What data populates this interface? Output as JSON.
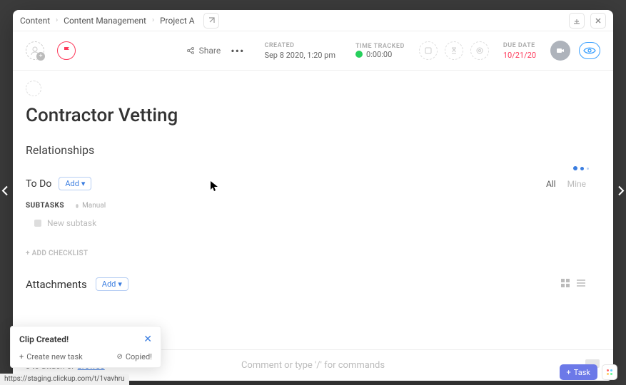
{
  "breadcrumb": {
    "items": [
      "Content",
      "Content Management",
      "Project A"
    ]
  },
  "header": {
    "share_label": "Share",
    "created_label": "CREATED",
    "created_value": "Sep 8 2020, 1:20 pm",
    "time_tracked_label": "TIME TRACKED",
    "time_tracked_value": "0:00:00",
    "due_label": "DUE DATE",
    "due_value": "10/21/20"
  },
  "task": {
    "title": "Contractor Vetting",
    "relationships_label": "Relationships"
  },
  "todo": {
    "label": "To Do",
    "add_label": "Add",
    "tabs": {
      "all": "All",
      "mine": "Mine"
    },
    "subtasks_label": "SUBTASKS",
    "manual_label": "Manual",
    "new_subtask_placeholder": "New subtask",
    "add_checklist_label": "+ ADD CHECKLIST"
  },
  "attachments": {
    "label": "Attachments",
    "add_label": "Add"
  },
  "footer": {
    "drop_prefix": "e to attach or ",
    "browse_label": "browse",
    "comment_placeholder": "Comment or type '/' for commands"
  },
  "toast": {
    "title": "Clip Created!",
    "create_label": "Create new task",
    "copied_label": "Copied!"
  },
  "bottom": {
    "url": "https://staging.clickup.com/t/1vavhru",
    "task_label": "Task"
  }
}
